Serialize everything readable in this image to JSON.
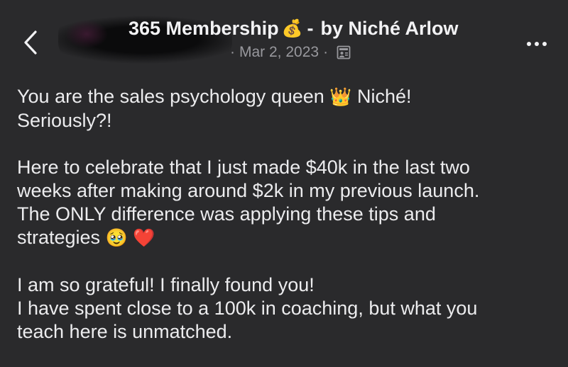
{
  "header": {
    "back_icon": "chevron-left-icon",
    "title": "365 Membership",
    "title_emoji": "💰",
    "title_separator": "-",
    "author_prefix": "by",
    "author": "Niché Arlow",
    "date": "Mar 2, 2023",
    "meta_dot": "·",
    "visibility_icon": "photo-album-icon",
    "more_icon": "more-options-icon"
  },
  "post": {
    "p1": {
      "l1_text": "You are the sales psychology queen",
      "l1_emoji": "👑",
      "l1_tail": "Niché!",
      "l2": "Seriously?!"
    },
    "p2": {
      "l1": "Here to celebrate that I just made $40k in the last two",
      "l2": "weeks after making around $2k in my previous launch.",
      "l3": "The ONLY difference was applying these tips and",
      "l4_text": "strategies",
      "l4_emoji1": "🥹",
      "l4_emoji2": "❤️"
    },
    "p3": {
      "l1": "I am so grateful! I finally found you!",
      "l2": "I have spent close to a 100k in coaching, but what you",
      "l3": "teach here is unmatched."
    }
  },
  "colors": {
    "background": "#2a2a2c",
    "text": "#ececee",
    "meta_text": "#98989d"
  }
}
